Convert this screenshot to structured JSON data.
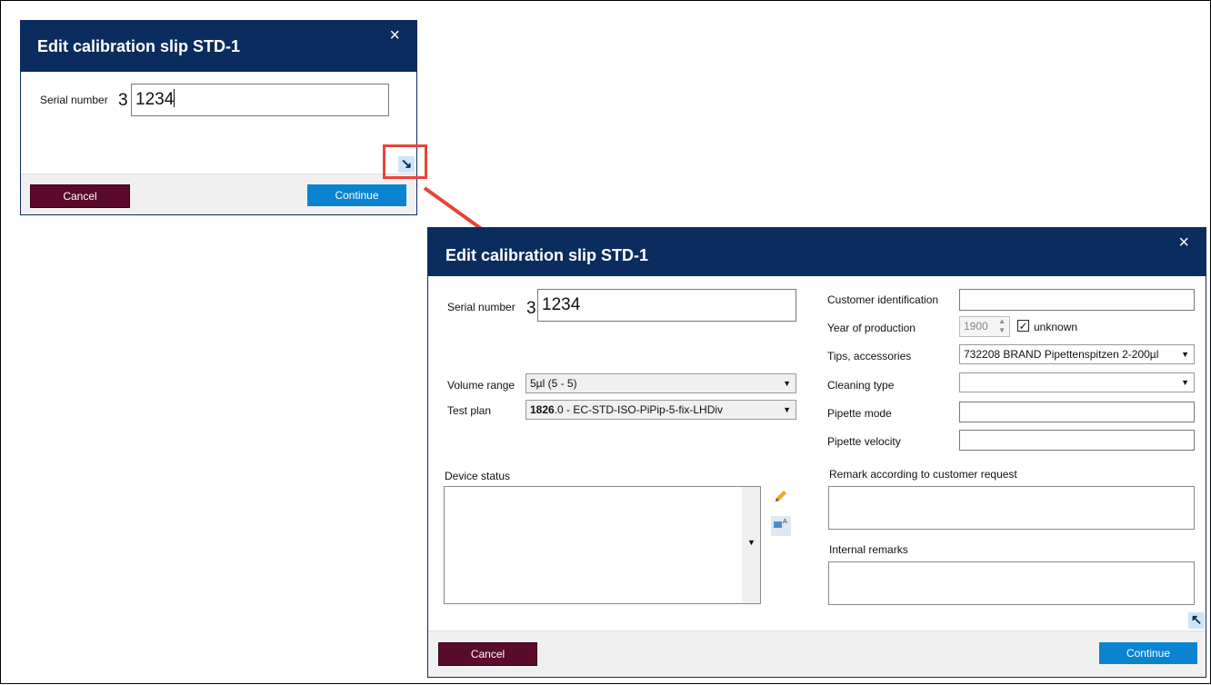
{
  "small_dialog": {
    "title": "Edit calibration slip STD-1",
    "serial_label": "Serial number",
    "serial_prefix": "3",
    "serial_value": "1234",
    "cancel_label": "Cancel",
    "continue_label": "Continue",
    "expand_icon": "↘"
  },
  "large_dialog": {
    "title": "Edit calibration slip STD-1",
    "serial_label": "Serial number",
    "serial_prefix": "3",
    "serial_value": "1234",
    "volume_range_label": "Volume range",
    "volume_range_value": "5µl (5 - 5)",
    "test_plan_label": "Test plan",
    "test_plan_bold": "1826",
    "test_plan_rest": ".0 - EC-STD-ISO-PiPip-5-fix-LHDiv",
    "customer_id_label": "Customer identification",
    "customer_id_value": "",
    "year_label": "Year of production",
    "year_value": "1900",
    "unknown_label": "unknown",
    "unknown_checked": true,
    "tips_label": "Tips, accessories",
    "tips_value": "732208 BRAND Pipettenspitzen 2-200µl",
    "cleaning_label": "Cleaning type",
    "cleaning_value": "",
    "pipette_mode_label": "Pipette mode",
    "pipette_mode_value": "",
    "pipette_velocity_label": "Pipette velocity",
    "pipette_velocity_value": "",
    "device_status_label": "Device status",
    "remark_label": "Remark according to customer request",
    "internal_remarks_label": "Internal remarks",
    "cancel_label": "Cancel",
    "continue_label": "Continue",
    "collapse_icon": "↖"
  },
  "colors": {
    "header": "#0b2c5f",
    "cancel": "#5a0a2a",
    "continue": "#0a84d0",
    "annotation": "#e8433a"
  }
}
